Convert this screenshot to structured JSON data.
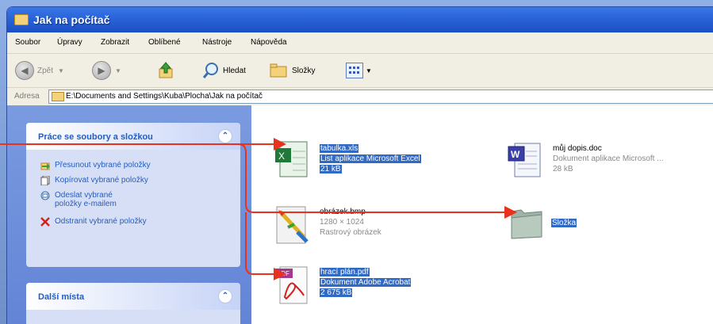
{
  "window": {
    "title": "Jak na počítač"
  },
  "menu": [
    "Soubor",
    "Úpravy",
    "Zobrazit",
    "Oblíbené",
    "Nástroje",
    "Nápověda"
  ],
  "toolbar": {
    "back": "Zpět",
    "search": "Hledat",
    "folders": "Složky"
  },
  "address": {
    "label": "Adresa",
    "path": "E:\\Documents and Settings\\Kuba\\Plocha\\Jak na počítač"
  },
  "tasks_panel": {
    "title": "Práce se soubory a složkou",
    "items": [
      "Přesunout vybrané položky",
      "Kopírovat vybrané položky",
      "Odeslat vybrané položky e-mailem",
      "Odstranit vybrané položky"
    ]
  },
  "places_panel": {
    "title": "Další místa"
  },
  "files": [
    {
      "name": "tabulka.xls",
      "type": "List aplikace Microsoft Excel",
      "size": "21 kB",
      "icon": "excel-icon",
      "selected": true
    },
    {
      "name": "můj dopis.doc",
      "type": "Dokument aplikace Microsoft ...",
      "size": "28 kB",
      "icon": "word-icon",
      "selected": false
    },
    {
      "name": "obrázek.bmp",
      "type": "1280 × 1024",
      "size": "Rastrový obrázek",
      "icon": "paint-icon",
      "selected": false
    },
    {
      "name": "Složka",
      "icon": "folder-icon",
      "selected": true
    },
    {
      "name": "hrací plán.pdf",
      "type": "Dokument Adobe Acrobat",
      "size": "2 675 kB",
      "icon": "pdf-icon",
      "selected": true
    }
  ],
  "colors": {
    "selection": "#316ac5",
    "annotation_arrow": "#e8321e",
    "titlebar": "#2a63d8"
  }
}
